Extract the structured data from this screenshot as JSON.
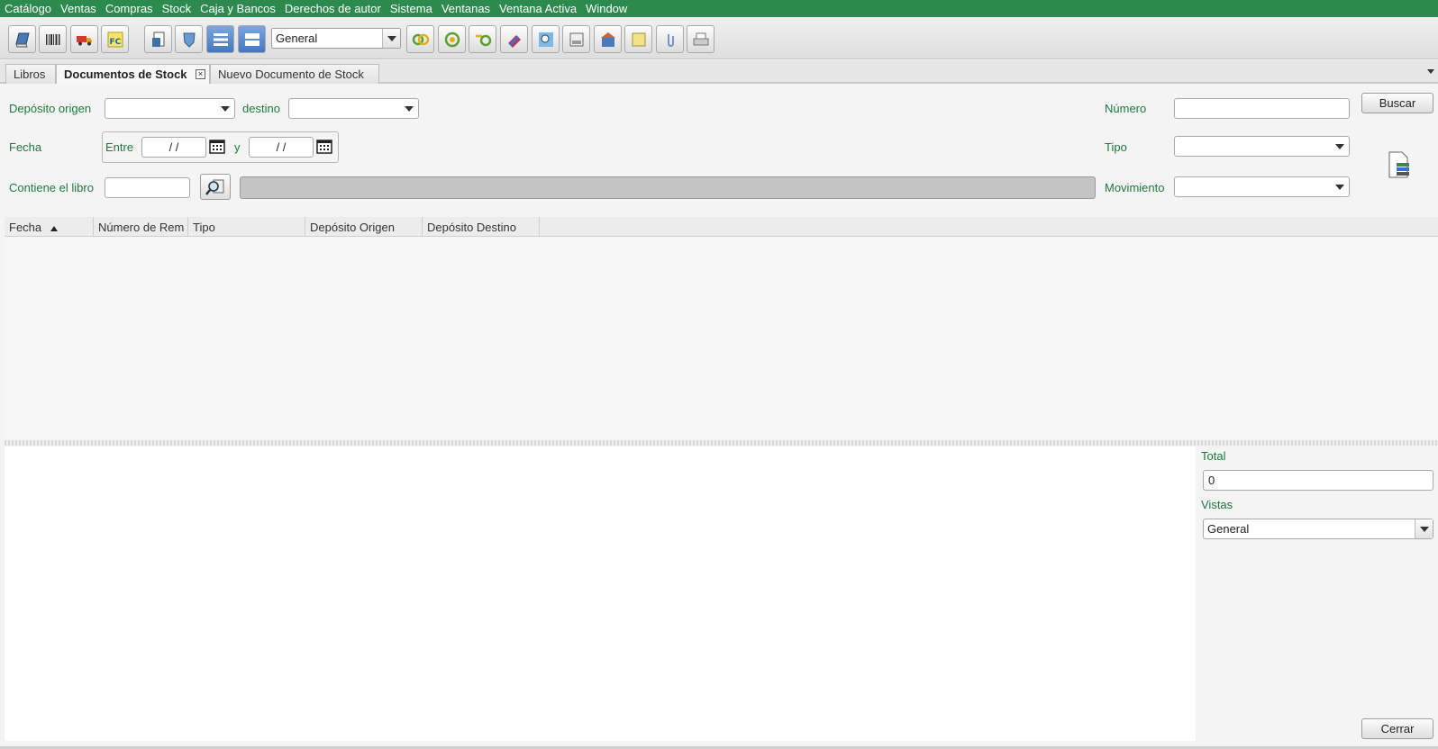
{
  "menu": [
    "Catálogo",
    "Ventas",
    "Compras",
    "Stock",
    "Caja y Bancos",
    "Derechos de autor",
    "Sistema",
    "Ventanas",
    "Ventana Activa",
    "Window"
  ],
  "toolbar": {
    "view_select": "General"
  },
  "tabs": [
    {
      "label": "Libros"
    },
    {
      "label": "Documentos de Stock"
    },
    {
      "label": "Nuevo Documento de Stock"
    }
  ],
  "filters": {
    "deposito_origen_label": "Depósito origen",
    "destino_label": "destino",
    "fecha_label": "Fecha",
    "entre_label": "Entre",
    "y_label": "y",
    "date_from": " /  / ",
    "date_to": " /  / ",
    "contiene_label": "Contiene el libro",
    "numero_label": "Número",
    "tipo_label": "Tipo",
    "movimiento_label": "Movimiento",
    "buscar_button": "Buscar"
  },
  "table": {
    "columns": [
      "Fecha",
      "Número de Rem",
      "Tipo",
      "Depósito Origen",
      "Depósito Destino"
    ]
  },
  "summary": {
    "total_label": "Total",
    "total_value": "0",
    "vistas_label": "Vistas",
    "vistas_value": "General"
  },
  "cerrar_button": "Cerrar",
  "colors": {
    "menubar": "#2d8a4e",
    "label": "#1d7a3a"
  }
}
